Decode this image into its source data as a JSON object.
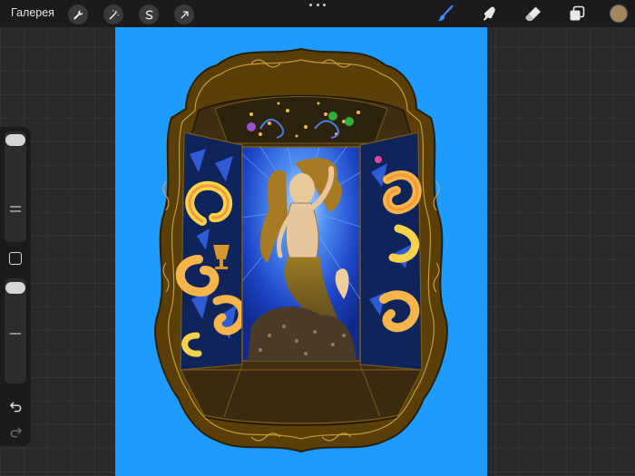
{
  "toolbar": {
    "gallery_label": "Галерея",
    "left_tools": [
      "wrench-icon",
      "magic-wand-icon",
      "selection-icon",
      "transform-arrow-icon"
    ],
    "right_tools": [
      "brush-icon",
      "smudge-icon",
      "eraser-icon",
      "layers-icon"
    ],
    "active_tool": "brush-icon",
    "accent_color": "#3f8cff",
    "current_color": "#a3865f"
  },
  "sidebar": {
    "brush_size": 0.05,
    "brush_opacity": 0.05,
    "controls": [
      "brush-size-slider",
      "modify-button",
      "opacity-slider",
      "undo-icon",
      "redo-icon"
    ]
  },
  "canvas": {
    "background": "#1e9bff",
    "frame_color": "#5a3f08",
    "interior_color": "#3f2f12"
  }
}
